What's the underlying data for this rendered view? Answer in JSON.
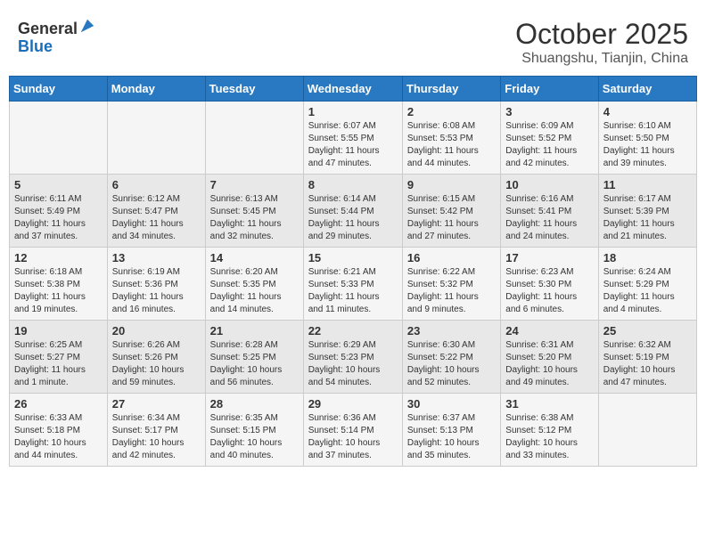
{
  "header": {
    "logo_general": "General",
    "logo_blue": "Blue",
    "month_title": "October 2025",
    "location": "Shuangshu, Tianjin, China"
  },
  "weekdays": [
    "Sunday",
    "Monday",
    "Tuesday",
    "Wednesday",
    "Thursday",
    "Friday",
    "Saturday"
  ],
  "weeks": [
    [
      {
        "day": "",
        "info": ""
      },
      {
        "day": "",
        "info": ""
      },
      {
        "day": "",
        "info": ""
      },
      {
        "day": "1",
        "info": "Sunrise: 6:07 AM\nSunset: 5:55 PM\nDaylight: 11 hours\nand 47 minutes."
      },
      {
        "day": "2",
        "info": "Sunrise: 6:08 AM\nSunset: 5:53 PM\nDaylight: 11 hours\nand 44 minutes."
      },
      {
        "day": "3",
        "info": "Sunrise: 6:09 AM\nSunset: 5:52 PM\nDaylight: 11 hours\nand 42 minutes."
      },
      {
        "day": "4",
        "info": "Sunrise: 6:10 AM\nSunset: 5:50 PM\nDaylight: 11 hours\nand 39 minutes."
      }
    ],
    [
      {
        "day": "5",
        "info": "Sunrise: 6:11 AM\nSunset: 5:49 PM\nDaylight: 11 hours\nand 37 minutes."
      },
      {
        "day": "6",
        "info": "Sunrise: 6:12 AM\nSunset: 5:47 PM\nDaylight: 11 hours\nand 34 minutes."
      },
      {
        "day": "7",
        "info": "Sunrise: 6:13 AM\nSunset: 5:45 PM\nDaylight: 11 hours\nand 32 minutes."
      },
      {
        "day": "8",
        "info": "Sunrise: 6:14 AM\nSunset: 5:44 PM\nDaylight: 11 hours\nand 29 minutes."
      },
      {
        "day": "9",
        "info": "Sunrise: 6:15 AM\nSunset: 5:42 PM\nDaylight: 11 hours\nand 27 minutes."
      },
      {
        "day": "10",
        "info": "Sunrise: 6:16 AM\nSunset: 5:41 PM\nDaylight: 11 hours\nand 24 minutes."
      },
      {
        "day": "11",
        "info": "Sunrise: 6:17 AM\nSunset: 5:39 PM\nDaylight: 11 hours\nand 21 minutes."
      }
    ],
    [
      {
        "day": "12",
        "info": "Sunrise: 6:18 AM\nSunset: 5:38 PM\nDaylight: 11 hours\nand 19 minutes."
      },
      {
        "day": "13",
        "info": "Sunrise: 6:19 AM\nSunset: 5:36 PM\nDaylight: 11 hours\nand 16 minutes."
      },
      {
        "day": "14",
        "info": "Sunrise: 6:20 AM\nSunset: 5:35 PM\nDaylight: 11 hours\nand 14 minutes."
      },
      {
        "day": "15",
        "info": "Sunrise: 6:21 AM\nSunset: 5:33 PM\nDaylight: 11 hours\nand 11 minutes."
      },
      {
        "day": "16",
        "info": "Sunrise: 6:22 AM\nSunset: 5:32 PM\nDaylight: 11 hours\nand 9 minutes."
      },
      {
        "day": "17",
        "info": "Sunrise: 6:23 AM\nSunset: 5:30 PM\nDaylight: 11 hours\nand 6 minutes."
      },
      {
        "day": "18",
        "info": "Sunrise: 6:24 AM\nSunset: 5:29 PM\nDaylight: 11 hours\nand 4 minutes."
      }
    ],
    [
      {
        "day": "19",
        "info": "Sunrise: 6:25 AM\nSunset: 5:27 PM\nDaylight: 11 hours\nand 1 minute."
      },
      {
        "day": "20",
        "info": "Sunrise: 6:26 AM\nSunset: 5:26 PM\nDaylight: 10 hours\nand 59 minutes."
      },
      {
        "day": "21",
        "info": "Sunrise: 6:28 AM\nSunset: 5:25 PM\nDaylight: 10 hours\nand 56 minutes."
      },
      {
        "day": "22",
        "info": "Sunrise: 6:29 AM\nSunset: 5:23 PM\nDaylight: 10 hours\nand 54 minutes."
      },
      {
        "day": "23",
        "info": "Sunrise: 6:30 AM\nSunset: 5:22 PM\nDaylight: 10 hours\nand 52 minutes."
      },
      {
        "day": "24",
        "info": "Sunrise: 6:31 AM\nSunset: 5:20 PM\nDaylight: 10 hours\nand 49 minutes."
      },
      {
        "day": "25",
        "info": "Sunrise: 6:32 AM\nSunset: 5:19 PM\nDaylight: 10 hours\nand 47 minutes."
      }
    ],
    [
      {
        "day": "26",
        "info": "Sunrise: 6:33 AM\nSunset: 5:18 PM\nDaylight: 10 hours\nand 44 minutes."
      },
      {
        "day": "27",
        "info": "Sunrise: 6:34 AM\nSunset: 5:17 PM\nDaylight: 10 hours\nand 42 minutes."
      },
      {
        "day": "28",
        "info": "Sunrise: 6:35 AM\nSunset: 5:15 PM\nDaylight: 10 hours\nand 40 minutes."
      },
      {
        "day": "29",
        "info": "Sunrise: 6:36 AM\nSunset: 5:14 PM\nDaylight: 10 hours\nand 37 minutes."
      },
      {
        "day": "30",
        "info": "Sunrise: 6:37 AM\nSunset: 5:13 PM\nDaylight: 10 hours\nand 35 minutes."
      },
      {
        "day": "31",
        "info": "Sunrise: 6:38 AM\nSunset: 5:12 PM\nDaylight: 10 hours\nand 33 minutes."
      },
      {
        "day": "",
        "info": ""
      }
    ]
  ]
}
